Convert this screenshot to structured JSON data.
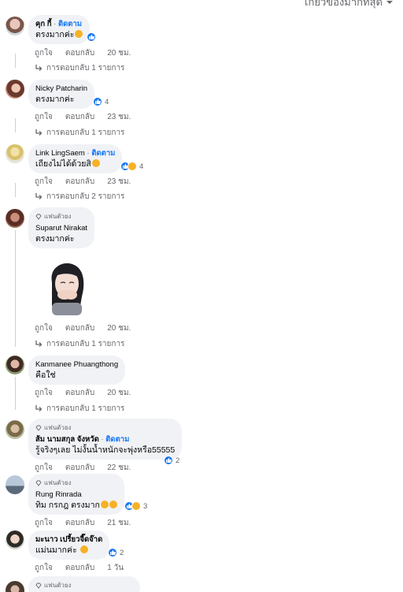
{
  "sort": {
    "label": "เกี่ยวข้องมากที่สุด"
  },
  "comments": [
    {
      "author": "คุก กี้",
      "follow": "ติดตาม",
      "text": "ตรงมากค่ะ",
      "time": "20 ชม.",
      "like": "ถูกใจ",
      "reply": "ตอบกลับ",
      "replies": "การตอบกลับ 1 รายการ"
    },
    {
      "author": "Nicky Patcharin",
      "text": "ตรงมากค่ะ",
      "react_count": "4",
      "time": "23 ชม.",
      "like": "ถูกใจ",
      "reply": "ตอบกลับ",
      "replies": "การตอบกลับ 1 รายการ"
    },
    {
      "author": "Link LingSaem",
      "follow": "ติดตาม",
      "text": "เถียงไม่ได้ด้วยสิ",
      "react_count": "4",
      "time": "23 ชม.",
      "like": "ถูกใจ",
      "reply": "ตอบกลับ",
      "replies": "การตอบกลับ 2 รายการ"
    },
    {
      "badge": "แฟนตัวยง",
      "author": "Suparut Nirakat",
      "text": "ตรงมากค่ะ",
      "time": "20 ชม.",
      "like": "ถูกใจ",
      "reply": "ตอบกลับ",
      "replies": "การตอบกลับ 1 รายการ"
    },
    {
      "author": "Kanmanee Phuangthong",
      "text": "คือใช่",
      "time": "20 ชม.",
      "like": "ถูกใจ",
      "reply": "ตอบกลับ",
      "replies": "การตอบกลับ 1 รายการ"
    },
    {
      "badge": "แฟนตัวยง",
      "author": "ส้ม นามสกุล จังหวัด",
      "follow": "ติดตาม",
      "text": "รู้จริงๆเลย ไม่งั้นน้ำหนักจะพุ่งหรือ55555",
      "react_count": "2",
      "time": "22 ชม.",
      "like": "ถูกใจ",
      "reply": "ตอบกลับ"
    },
    {
      "badge": "แฟนตัวยง",
      "author": "Rung Rinrada",
      "text": "ทิม กรกฎ ตรงมาก",
      "react_count": "3",
      "time": "21 ชม.",
      "like": "ถูกใจ",
      "reply": "ตอบกลับ"
    },
    {
      "author": "มะนาว เปรี้ยวจี๊ดจ๊าด",
      "text": "แม่นมากค่ะ",
      "react_count": "2",
      "time": "1 วัน",
      "like": "ถูกใจ",
      "reply": "ตอบกลับ"
    },
    {
      "badge": "แฟนตัวยง"
    }
  ],
  "colors": {
    "link": "#1877f2",
    "bubble": "#f0f2f5",
    "meta": "#65676b",
    "like_blue": "#1877f2",
    "haha_yellow": "#f7b125"
  }
}
